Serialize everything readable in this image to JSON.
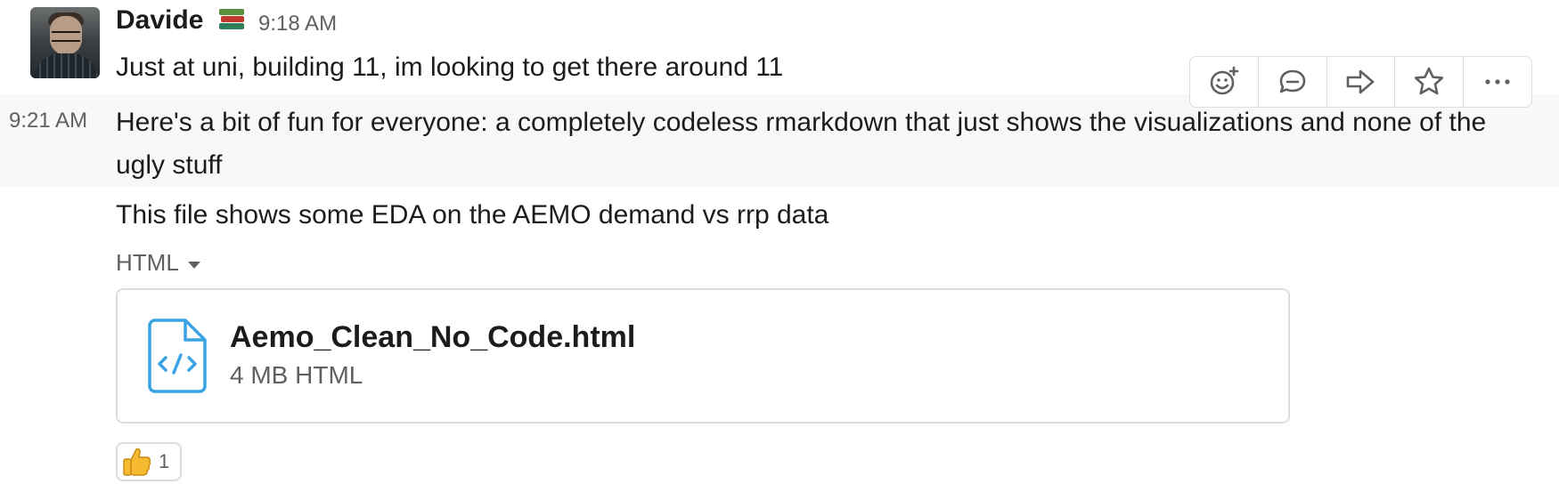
{
  "message_header": {
    "sender": "Davide",
    "status_emoji": "books-emoji",
    "time": "9:18 AM"
  },
  "messages": [
    {
      "text": "Just at uni, building 11, im looking to get there around 11"
    },
    {
      "time": "9:21 AM",
      "text": "Here's a bit of fun for everyone: a completely codeless rmarkdown that just shows the visualizations and none of the ugly stuff"
    },
    {
      "text": "This file shows some EDA on the AEMO demand vs rrp data"
    }
  ],
  "hover_toolbar": {
    "actions": [
      "add-reaction-icon",
      "reply-thread-icon",
      "share-message-icon",
      "save-star-icon",
      "more-actions-icon"
    ]
  },
  "attachment": {
    "type_label": "HTML",
    "file_name": "Aemo_Clean_No_Code.html",
    "file_meta": "4 MB HTML",
    "icon": "html-file-icon",
    "icon_color": "#3aa3e3"
  },
  "reaction": {
    "emoji": "thumbs-up",
    "count": "1"
  }
}
